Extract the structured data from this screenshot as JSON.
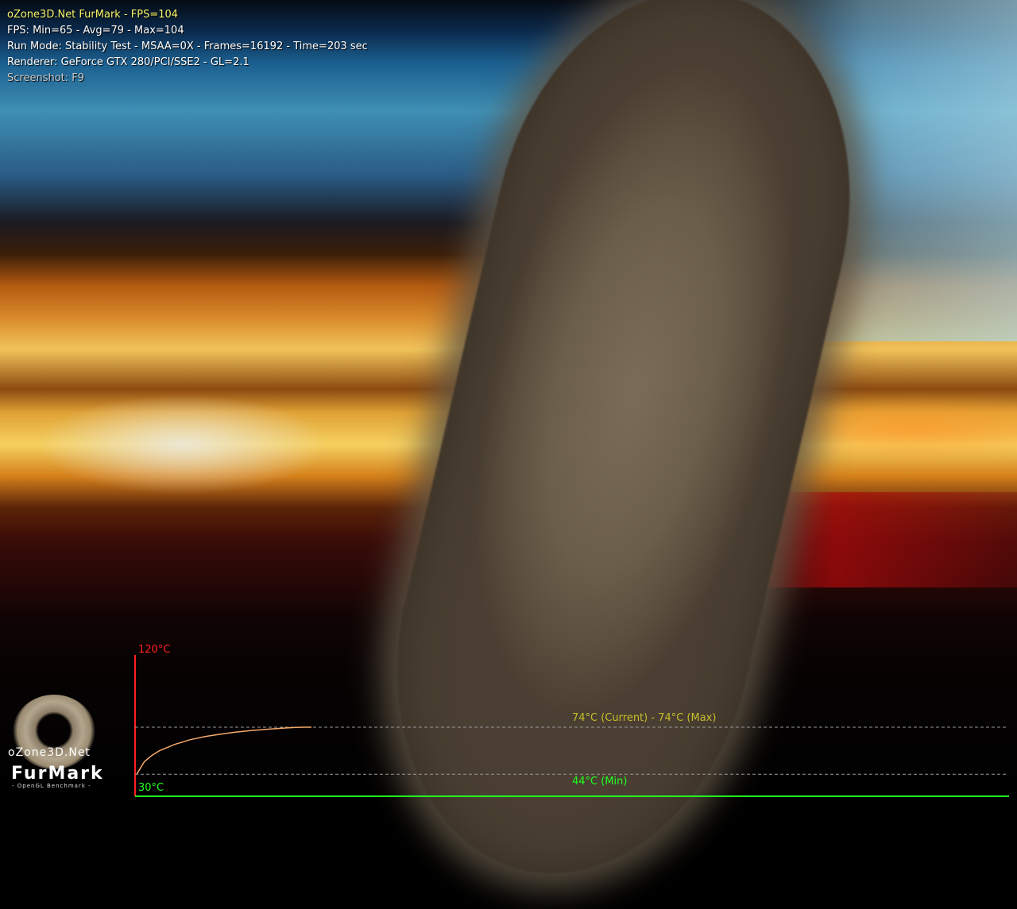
{
  "hud": {
    "title": "oZone3D.Net FurMark - FPS=104",
    "fps": "FPS: Min=65 - Avg=79 - Max=104",
    "run_mode": "Run Mode: Stability Test - MSAA=0X - Frames=16192 - Time=203 sec",
    "renderer": "Renderer: GeForce GTX 280/PCI/SSE2 - GL=2.1",
    "screenshot": "Screenshot: F9"
  },
  "logo": {
    "site": "oZone3D.Net",
    "name": "FurMark",
    "subtitle": "- OpenGL Benchmark -"
  },
  "temperature_graph": {
    "max_label": "120°C",
    "min_label": "30°C",
    "current_label": "74°C (Current) - 74°C (Max)",
    "min_line_label": "44°C (Min)",
    "colors": {
      "axis_y": "#ff2020",
      "axis_x": "#22ff22",
      "curve": "#f5a96a",
      "current_text": "#c8bf2a",
      "min_text": "#22ff22"
    }
  },
  "chart_data": {
    "type": "line",
    "title": "",
    "xlabel": "",
    "ylabel": "",
    "ylim": [
      30,
      120
    ],
    "series": [
      {
        "values": [
          44,
          52,
          56,
          59,
          61,
          63,
          64.5,
          66,
          67,
          68,
          68.8,
          69.5,
          70.2,
          70.8,
          71.3,
          71.8,
          72.2,
          72.6,
          73,
          73.3,
          73.6,
          73.9,
          74,
          74
        ]
      }
    ],
    "reference_lines": [
      74,
      44
    ]
  }
}
